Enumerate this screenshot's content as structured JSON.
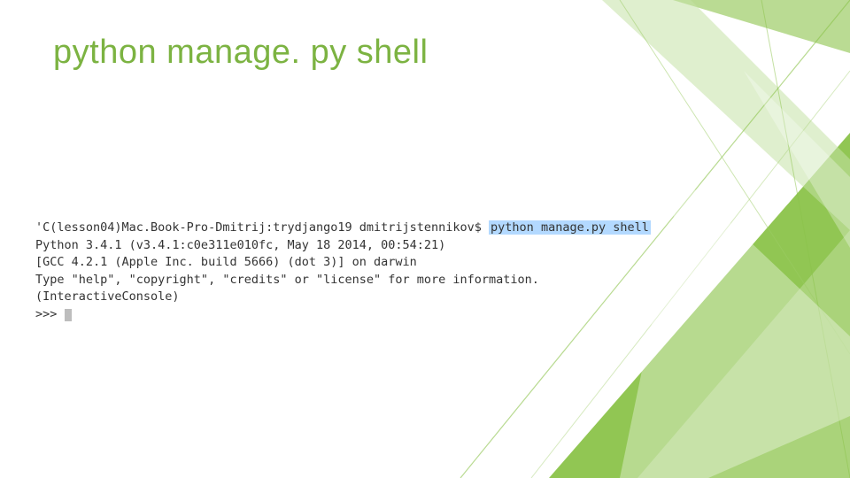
{
  "title": "python manage. py shell",
  "terminal": {
    "line1_prefix": "'C(lesson04)Mac.Book-Pro-Dmitrij:trydjango19 dmitrijstennikov$ ",
    "line1_cmd": "python manage.py shell",
    "line2": "Python 3.4.1 (v3.4.1:c0e311e010fc, May 18 2014, 00:54:21)",
    "line3": "[GCC 4.2.1 (Apple Inc. build 5666) (dot 3)] on darwin",
    "line4": "Type \"help\", \"copyright\", \"credits\" or \"license\" for more information.",
    "line5": "(InteractiveConsole)",
    "line6_prompt": ">>> "
  }
}
